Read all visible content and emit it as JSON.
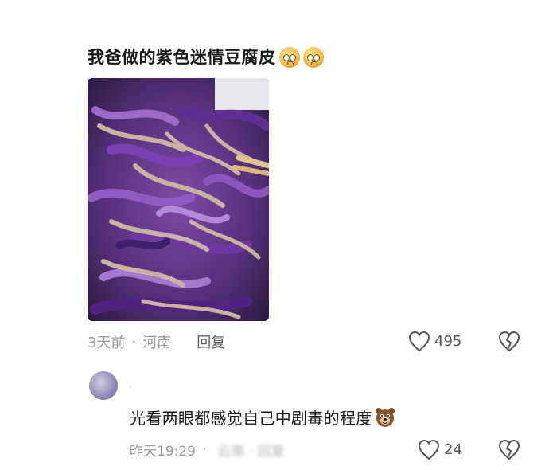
{
  "comment1": {
    "text": "我爸做的紫色迷情豆腐皮",
    "emojis": [
      "pleading-face-emoji",
      "pleading-face-emoji"
    ],
    "time": "3天前",
    "separator": "·",
    "location": "河南",
    "reply_label": "回复",
    "like_count": "495"
  },
  "comment2": {
    "avatar_dot": "·",
    "text": "光看两眼都感觉自己中剧毒的程度",
    "emoji": "bear-face-emoji",
    "time": "昨天19:29",
    "separator": "·",
    "obscured_text": "云南 · 回复",
    "like_count": "24"
  },
  "colors": {
    "text_primary": "#1a1a1a",
    "text_secondary": "#9a9a9a",
    "icon": "#555555",
    "photo_purple": "#6a3d8c"
  }
}
